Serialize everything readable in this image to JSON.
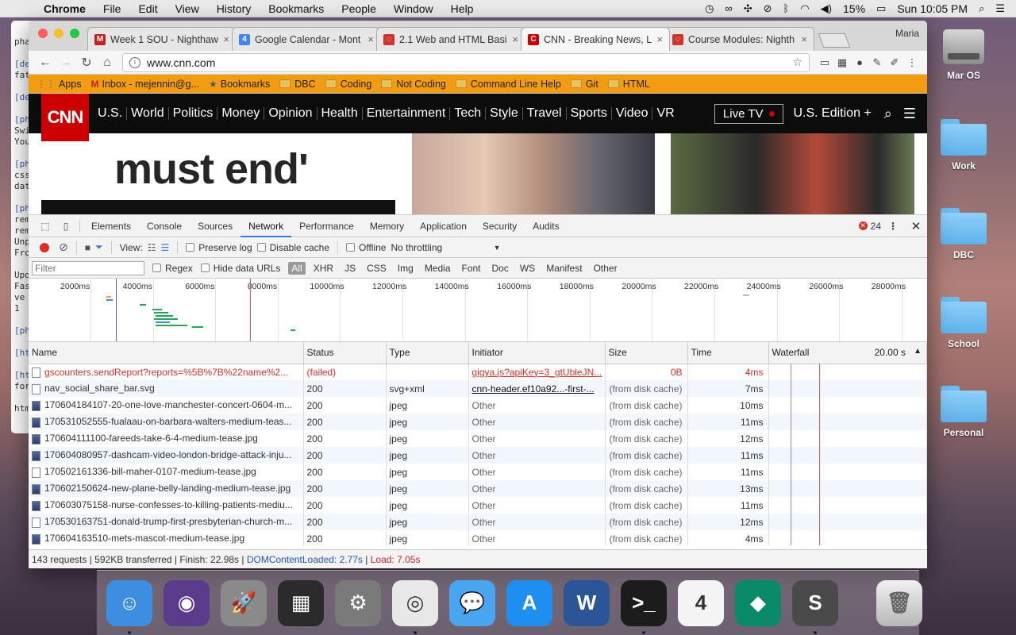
{
  "menubar": {
    "app_name": "Chrome",
    "items": [
      "File",
      "Edit",
      "View",
      "History",
      "Bookmarks",
      "People",
      "Window",
      "Help"
    ],
    "battery": "15%",
    "clock": "Sun 10:05 PM"
  },
  "desktop": {
    "icons": [
      {
        "label": "Mar OS",
        "kind": "disk-icon"
      },
      {
        "label": "Work",
        "kind": "folder-icon"
      },
      {
        "label": "DBC",
        "kind": "folder-icon"
      },
      {
        "label": "School",
        "kind": "folder-icon"
      },
      {
        "label": "Personal",
        "kind": "folder-icon"
      }
    ]
  },
  "terminal": {
    "lines": [
      "pha",
      "",
      "[dev",
      "fat",
      "",
      "[dev",
      "",
      "[pha",
      "Swi",
      "You",
      "",
      "[pha",
      "css",
      "dat",
      "",
      "[pha",
      "rem",
      "rem",
      "Unp",
      "Fro",
      "",
      "Upd",
      "Fas",
      " ve",
      " 1",
      "",
      "[pha",
      "",
      "[htm",
      "",
      "[htm",
      "for",
      "",
      "htm"
    ]
  },
  "browser": {
    "profile_name": "Maria",
    "tabs": [
      {
        "title": "Week 1 SOU - Nighthaw",
        "fav_color": "#c5221f",
        "fav_glyph": "M",
        "active": false
      },
      {
        "title": "Google Calendar - Mont",
        "fav_color": "#4285f4",
        "fav_glyph": "4",
        "active": false
      },
      {
        "title": "2.1 Web and HTML Basi",
        "fav_color": "#d0342c",
        "fav_glyph": "◌",
        "active": false
      },
      {
        "title": "CNN - Breaking News, L",
        "fav_color": "#cc0000",
        "fav_glyph": "C",
        "active": true
      },
      {
        "title": "Course Modules: Nighth",
        "fav_color": "#d0342c",
        "fav_glyph": "◌",
        "active": false
      }
    ],
    "url": "www.cnn.com",
    "bookmarks": [
      {
        "label": "Apps",
        "kind": "apps-icon"
      },
      {
        "label": "Inbox - mejennin@g...",
        "kind": "gmail-icon"
      },
      {
        "label": "Bookmarks",
        "kind": "star-icon"
      },
      {
        "label": "DBC",
        "kind": "folder-icon"
      },
      {
        "label": "Coding",
        "kind": "folder-icon"
      },
      {
        "label": "Not Coding",
        "kind": "folder-icon"
      },
      {
        "label": "Command Line Help",
        "kind": "folder-icon"
      },
      {
        "label": "Git",
        "kind": "folder-icon"
      },
      {
        "label": "HTML",
        "kind": "folder-icon"
      }
    ]
  },
  "cnn": {
    "logo": "CNN",
    "nav": [
      "U.S.",
      "World",
      "Politics",
      "Money",
      "Opinion",
      "Health",
      "Entertainment",
      "Tech",
      "Style",
      "Travel",
      "Sports",
      "Video",
      "VR"
    ],
    "live_tv": "Live TV",
    "edition": "U.S. Edition +",
    "headline_top": "' ' '  '  '  '",
    "headline": "must end'"
  },
  "devtools": {
    "tabs": [
      "Elements",
      "Console",
      "Sources",
      "Network",
      "Performance",
      "Memory",
      "Application",
      "Security",
      "Audits"
    ],
    "active_tab": "Network",
    "error_count": "24",
    "toolbar": {
      "view_label": "View:",
      "preserve_log": "Preserve log",
      "disable_cache": "Disable cache",
      "offline": "Offline",
      "throttling": "No throttling"
    },
    "filter": {
      "placeholder": "Filter",
      "regex": "Regex",
      "hide_data_urls": "Hide data URLs",
      "types": [
        "All",
        "XHR",
        "JS",
        "CSS",
        "Img",
        "Media",
        "Font",
        "Doc",
        "WS",
        "Manifest",
        "Other"
      ]
    },
    "timeline_ticks": [
      "2000ms",
      "4000ms",
      "6000ms",
      "8000ms",
      "10000ms",
      "12000ms",
      "14000ms",
      "16000ms",
      "18000ms",
      "20000ms",
      "22000ms",
      "24000ms",
      "26000ms",
      "28000ms"
    ],
    "columns": [
      "Name",
      "Status",
      "Type",
      "Initiator",
      "Size",
      "Time",
      "Waterfall"
    ],
    "waterfall_scale": "20.00 s",
    "rows": [
      {
        "name": "gscounters.sendReport?reports=%5B%7B%22name%2...",
        "status": "(failed)",
        "type": "",
        "initiator": "gigya.js?apiKey=3_gtUbleJN...",
        "size": "0B",
        "time": "4ms",
        "failed": true,
        "icon": "doc"
      },
      {
        "name": "nav_social_share_bar.svg",
        "status": "200",
        "type": "svg+xml",
        "initiator": "cnn-header.ef10a92...-first-...",
        "size": "(from disk cache)",
        "time": "7ms",
        "failed": false,
        "icon": "doc"
      },
      {
        "name": "170604184107-20-one-love-manchester-concert-0604-m...",
        "status": "200",
        "type": "jpeg",
        "initiator": "Other",
        "size": "(from disk cache)",
        "time": "10ms",
        "failed": false,
        "icon": "img"
      },
      {
        "name": "170531052555-fualaau-on-barbara-walters-medium-teas...",
        "status": "200",
        "type": "jpeg",
        "initiator": "Other",
        "size": "(from disk cache)",
        "time": "11ms",
        "failed": false,
        "icon": "img"
      },
      {
        "name": "170604111100-fareeds-take-6-4-medium-tease.jpg",
        "status": "200",
        "type": "jpeg",
        "initiator": "Other",
        "size": "(from disk cache)",
        "time": "12ms",
        "failed": false,
        "icon": "img"
      },
      {
        "name": "170604080957-dashcam-video-london-bridge-attack-inju...",
        "status": "200",
        "type": "jpeg",
        "initiator": "Other",
        "size": "(from disk cache)",
        "time": "11ms",
        "failed": false,
        "icon": "img"
      },
      {
        "name": "170502161336-bill-maher-0107-medium-tease.jpg",
        "status": "200",
        "type": "jpeg",
        "initiator": "Other",
        "size": "(from disk cache)",
        "time": "11ms",
        "failed": false,
        "icon": "doc"
      },
      {
        "name": "170602150624-new-plane-belly-landing-medium-tease.jpg",
        "status": "200",
        "type": "jpeg",
        "initiator": "Other",
        "size": "(from disk cache)",
        "time": "13ms",
        "failed": false,
        "icon": "img"
      },
      {
        "name": "170603075158-nurse-confesses-to-killing-patients-mediu...",
        "status": "200",
        "type": "jpeg",
        "initiator": "Other",
        "size": "(from disk cache)",
        "time": "11ms",
        "failed": false,
        "icon": "img"
      },
      {
        "name": "170530163751-donald-trump-first-presbyterian-church-m...",
        "status": "200",
        "type": "jpeg",
        "initiator": "Other",
        "size": "(from disk cache)",
        "time": "12ms",
        "failed": false,
        "icon": "doc"
      },
      {
        "name": "170604163510-mets-mascot-medium-tease.jpg",
        "status": "200",
        "type": "jpeg",
        "initiator": "Other",
        "size": "(from disk cache)",
        "time": "4ms",
        "failed": false,
        "icon": "img"
      }
    ],
    "status": {
      "summary": "143 requests | 592KB transferred | Finish: 22.98s |",
      "dom_loaded": "DOMContentLoaded: 2.77s",
      "load": "Load: 7.05s"
    }
  },
  "dock": {
    "apps": [
      {
        "name": "finder-icon",
        "color": "#3d8de0",
        "glyph": "☺",
        "running": true
      },
      {
        "name": "siri-icon",
        "color": "#5b3b8c",
        "glyph": "◉",
        "running": false
      },
      {
        "name": "launchpad-icon",
        "color": "#8a8a8a",
        "glyph": "🚀",
        "running": false
      },
      {
        "name": "photo-booth-icon",
        "color": "#2b2b2b",
        "glyph": "▦",
        "running": false
      },
      {
        "name": "system-preferences-icon",
        "color": "#7a7a7a",
        "glyph": "⚙",
        "running": false
      },
      {
        "name": "chrome-icon",
        "color": "#e8e8e8",
        "glyph": "◎",
        "running": true
      },
      {
        "name": "messages-icon",
        "color": "#4aa5f0",
        "glyph": "💬",
        "running": false
      },
      {
        "name": "app-store-icon",
        "color": "#1e8ef0",
        "glyph": "A",
        "running": false
      },
      {
        "name": "word-icon",
        "color": "#2b5597",
        "glyph": "W",
        "running": false
      },
      {
        "name": "terminal-icon",
        "color": "#1c1c1c",
        "glyph": ">_",
        "running": true
      },
      {
        "name": "calendar-icon",
        "color": "#f4f4f4",
        "glyph": "4",
        "running": false
      },
      {
        "name": "dashlane-icon",
        "color": "#0b8a6a",
        "glyph": "◆",
        "running": false
      },
      {
        "name": "sublime-text-icon",
        "color": "#4a4a4a",
        "glyph": "S",
        "running": true
      }
    ],
    "trash": {
      "name": "trash-icon"
    }
  },
  "colors": {
    "chrome_accent": "#3879d9",
    "cnn_red": "#cc0000",
    "error_red": "#d93025",
    "bookmark_bar_orange": "#f39c12"
  }
}
